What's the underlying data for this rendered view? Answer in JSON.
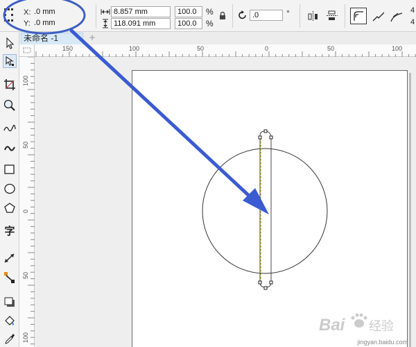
{
  "property_bar": {
    "x_label": "X:",
    "x_value": ".0 mm",
    "y_label": "Y:",
    "y_value": ".0 mm",
    "width_value": "8.857 mm",
    "height_value": "118.091 mm",
    "scale_x": "100.0",
    "scale_y": "100.0",
    "pct_symbol": "%",
    "rotation_value": ".0",
    "degree_symbol": "°",
    "overflow_x": "4",
    "overflow_y": "4"
  },
  "tabs": {
    "document_tab": "未命名 -1",
    "new_tab": "+"
  },
  "rulers": {
    "horizontal": [
      "150",
      "100",
      "50",
      "0",
      "50",
      "100"
    ],
    "vertical": [
      "100",
      "50",
      "0",
      "50",
      "100"
    ]
  },
  "toolbox": {
    "text_tool_glyph": "字"
  },
  "watermark": {
    "brand": "Bai",
    "brand_suffix": "经验",
    "url": "jingyan.baidu.com"
  },
  "annotation": {
    "ellipse_color": "#3d5fc4",
    "arrow_color": "#3a5bd1"
  },
  "colors": {
    "selection_highlight": "#d7e9f7",
    "page": "#ffffff",
    "canvas": "#eeeeee"
  }
}
